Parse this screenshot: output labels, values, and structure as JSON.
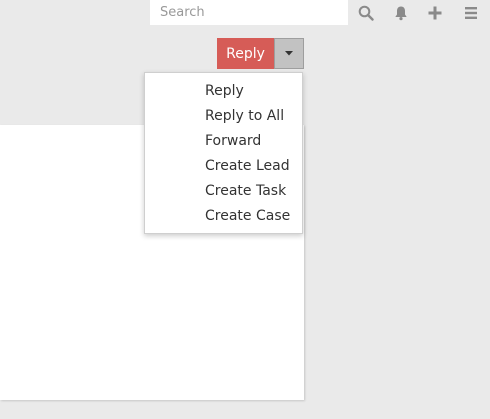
{
  "topbar": {
    "search_placeholder": "Search",
    "icons": [
      "search-icon",
      "bell-icon",
      "plus-icon",
      "menu-icon"
    ]
  },
  "reply_button": {
    "label": "Reply",
    "color": "#d65c57"
  },
  "reply_menu": {
    "items": [
      {
        "label": "Reply"
      },
      {
        "label": "Reply to All"
      },
      {
        "label": "Forward"
      },
      {
        "label": "Create Lead"
      },
      {
        "label": "Create Task"
      },
      {
        "label": "Create Case"
      }
    ]
  }
}
